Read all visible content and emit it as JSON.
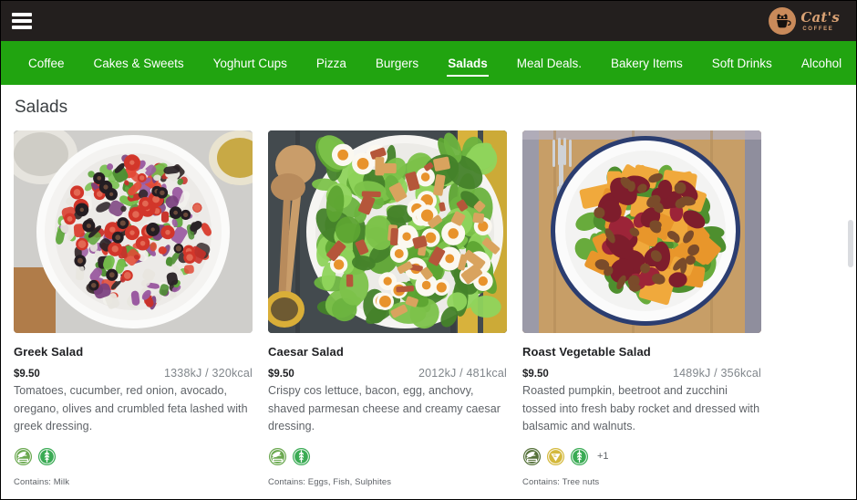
{
  "brand": {
    "name": "Cat's",
    "sub": "COFFEE",
    "mark_color": "#c98a5a",
    "text_color": "#d9a274"
  },
  "topbar": {
    "background": "#231f1e",
    "menu_icon": "hamburger-menu-icon"
  },
  "nav": {
    "background": "#21a410",
    "items": [
      {
        "label": "Coffee",
        "active": false
      },
      {
        "label": "Cakes & Sweets",
        "active": false
      },
      {
        "label": "Yoghurt Cups",
        "active": false
      },
      {
        "label": "Pizza",
        "active": false
      },
      {
        "label": "Burgers",
        "active": false
      },
      {
        "label": "Salads",
        "active": true
      },
      {
        "label": "Meal Deals.",
        "active": false
      },
      {
        "label": "Bakery Items",
        "active": false
      },
      {
        "label": "Soft Drinks",
        "active": false
      },
      {
        "label": "Alcohol",
        "active": false
      }
    ],
    "tools": [
      {
        "icon": "search-icon"
      },
      {
        "icon": "filter-sliders-icon"
      }
    ]
  },
  "page": {
    "title": "Salads"
  },
  "cards": [
    {
      "title": "Greek Salad",
      "price": "$9.50",
      "energy": "1338kJ / 320kcal",
      "description": "Tomatoes, cucumber, red onion, avocado, oregano, olives and crumbled feta lashed with greek dressing.",
      "image_alt": "greek-salad-photo",
      "badges": [
        {
          "name": "vegetarian-badge",
          "color": "#6aa84f"
        },
        {
          "name": "gluten-free-badge",
          "color": "#3aab54"
        }
      ],
      "more_badges": "",
      "contains": "Contains: Milk"
    },
    {
      "title": "Caesar Salad",
      "price": "$9.50",
      "energy": "2012kJ / 481kcal",
      "description": "Crispy cos lettuce, bacon, egg, anchovy, shaved parmesan cheese and creamy caesar dressing.",
      "image_alt": "caesar-salad-photo",
      "badges": [
        {
          "name": "vegetarian-badge",
          "color": "#6aa84f"
        },
        {
          "name": "gluten-free-badge",
          "color": "#3aab54"
        }
      ],
      "more_badges": "",
      "contains": "Contains: Eggs, Fish, Sulphites"
    },
    {
      "title": "Roast Vegetable Salad",
      "price": "$9.50",
      "energy": "1489kJ / 356kcal",
      "description": "Roasted pumpkin, beetroot and zucchini tossed into fresh baby rocket and dressed with balsamic and walnuts.",
      "image_alt": "roast-vegetable-salad-photo",
      "badges": [
        {
          "name": "vegetarian-badge",
          "color": "#55713a"
        },
        {
          "name": "vegan-badge",
          "color": "#d4b93c"
        },
        {
          "name": "gluten-free-badge",
          "color": "#3aab54"
        }
      ],
      "more_badges": "+1",
      "contains": "Contains: Tree nuts"
    }
  ]
}
